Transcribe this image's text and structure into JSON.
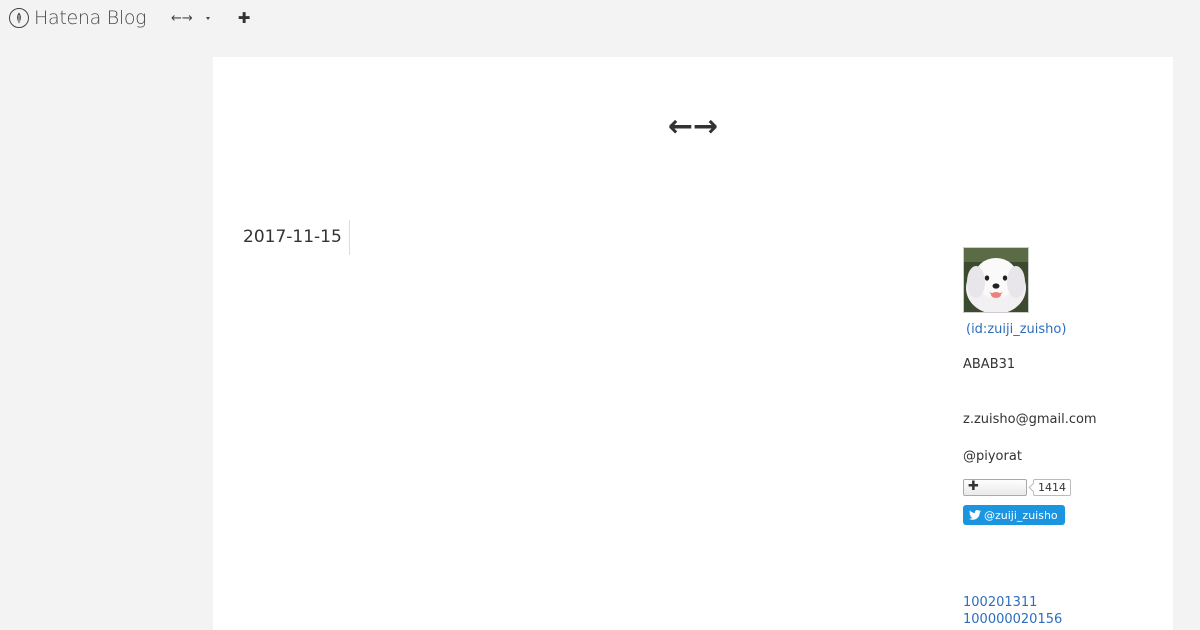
{
  "header": {
    "brand": "Hatena Blog",
    "blog_switcher_label": "←→"
  },
  "blog": {
    "title": "←→"
  },
  "archive": {
    "date": "2017-11-15"
  },
  "profile": {
    "id": "(id:zuiji_zuisho)",
    "description": "ABAB31",
    "email": "z.zuisho@gmail.com",
    "twitter_handle": "@piyorat",
    "follow_count": "1414",
    "twitter_follow_label": "@zuiji_zuisho"
  },
  "sidebar": {
    "links": [
      "100201311",
      "100000020156"
    ]
  },
  "colors": {
    "link": "#2c6ebd",
    "twitter": "#1b95e0",
    "page_bg": "#f3f3f3"
  }
}
